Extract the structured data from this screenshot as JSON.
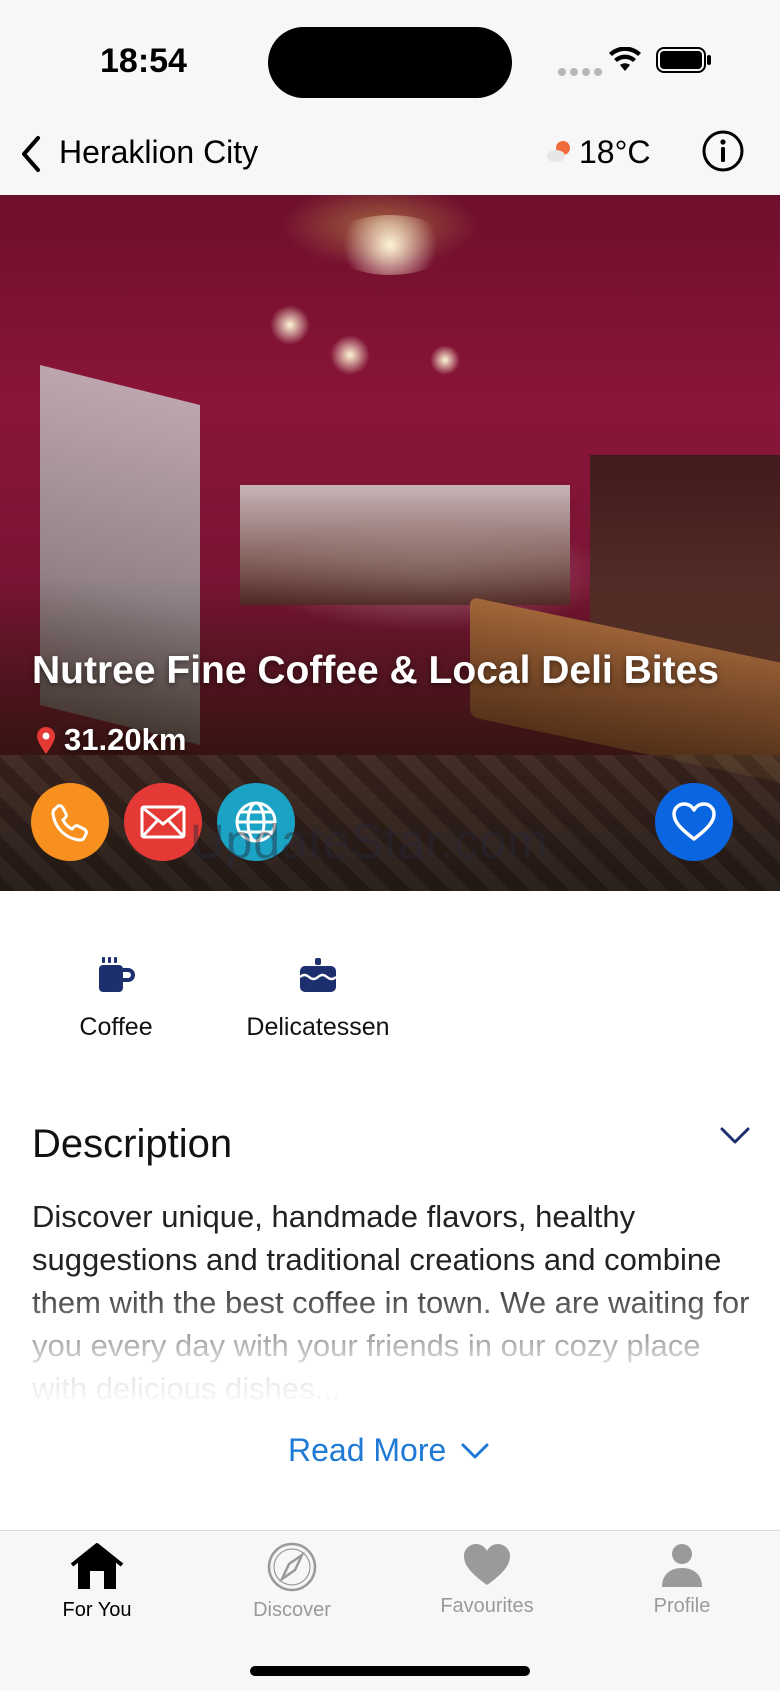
{
  "status_bar": {
    "time": "18:54"
  },
  "nav": {
    "title": "Heraklion City",
    "temperature": "18°C",
    "back_icon": "chevron-left-icon",
    "info_icon": "info-circle-icon",
    "weather_icon": "partly-cloudy-icon"
  },
  "place": {
    "name": "Nutree Fine Coffee & Local Deli Bites",
    "distance": "31.20km",
    "watermark": "UpdateStar.com",
    "actions": [
      {
        "name": "call",
        "icon": "phone-icon",
        "color": "#f7901e"
      },
      {
        "name": "email",
        "icon": "mail-icon",
        "color": "#e53935"
      },
      {
        "name": "website",
        "icon": "globe-icon",
        "color": "#1aa3c4"
      }
    ],
    "favourite": {
      "icon": "heart-outline-icon",
      "color": "#0a66e0"
    }
  },
  "categories": [
    {
      "label": "Coffee",
      "icon": "coffee-mug-icon"
    },
    {
      "label": "Delicatessen",
      "icon": "cake-icon"
    }
  ],
  "description": {
    "title": "Description",
    "text": "Discover unique, handmade flavors, healthy suggestions and traditional creations and combine them with the best coffee in town. We are waiting for you every day with your friends in our cozy place with delicious dishes...",
    "read_more": "Read More"
  },
  "tab_bar": {
    "items": [
      {
        "label": "For You",
        "icon": "home-icon",
        "active": true
      },
      {
        "label": "Discover",
        "icon": "compass-icon",
        "active": false
      },
      {
        "label": "Favourites",
        "icon": "heart-icon",
        "active": false
      },
      {
        "label": "Profile",
        "icon": "person-icon",
        "active": false
      }
    ]
  },
  "colors": {
    "accent": "#1f7ad6",
    "category_icon": "#1d2f6f",
    "hero_wall": "#8a1538"
  }
}
